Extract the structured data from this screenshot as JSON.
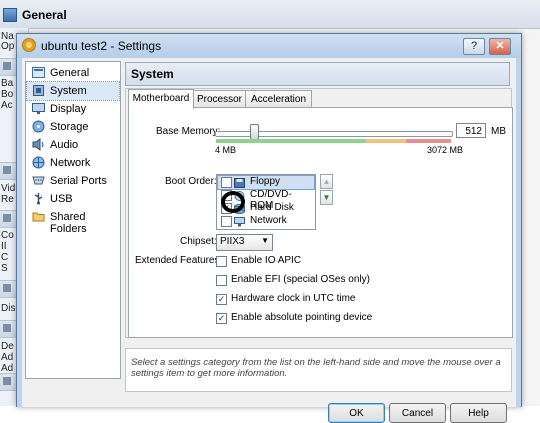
{
  "background_window": {
    "title": "General",
    "side_snippets": [
      "Na",
      "Op",
      "Ba",
      "Bo",
      "Ac",
      "Vid",
      "Re",
      "Co",
      "II",
      "C",
      "S",
      "Dis",
      "De",
      "Ad",
      "Ad"
    ]
  },
  "dialog": {
    "title": "ubuntu test2 - Settings",
    "window_buttons": {
      "help": "?",
      "minimize": "▭",
      "close": "✕"
    }
  },
  "categories": [
    {
      "label": "General",
      "icon": "general-icon",
      "selected": false
    },
    {
      "label": "System",
      "icon": "system-icon",
      "selected": true
    },
    {
      "label": "Display",
      "icon": "display-icon",
      "selected": false
    },
    {
      "label": "Storage",
      "icon": "storage-icon",
      "selected": false
    },
    {
      "label": "Audio",
      "icon": "audio-icon",
      "selected": false
    },
    {
      "label": "Network",
      "icon": "network-icon",
      "selected": false
    },
    {
      "label": "Serial Ports",
      "icon": "serial-port-icon",
      "selected": false
    },
    {
      "label": "USB",
      "icon": "usb-icon",
      "selected": false
    },
    {
      "label": "Shared Folders",
      "icon": "shared-folder-icon",
      "selected": false
    }
  ],
  "page": {
    "title": "System",
    "tabs": [
      {
        "label": "Motherboard",
        "active": true
      },
      {
        "label": "Processor",
        "active": false
      },
      {
        "label": "Acceleration",
        "active": false
      }
    ]
  },
  "motherboard": {
    "base_memory_label": "Base Memory:",
    "base_memory_value": "512",
    "base_memory_unit": "MB",
    "slider_min_label": "4 MB",
    "slider_max_label": "3072 MB",
    "slider_fraction": 0.165,
    "boot_order_label": "Boot Order:",
    "boot_items": [
      {
        "label": "Floppy",
        "checked": false,
        "selected": true
      },
      {
        "label": "CD/DVD-ROM",
        "checked": true,
        "selected": false
      },
      {
        "label": "Hard Disk",
        "checked": true,
        "selected": false
      },
      {
        "label": "Network",
        "checked": false,
        "selected": false
      }
    ],
    "chipset_label": "Chipset:",
    "chipset_value": "PIIX3",
    "extended_features_label": "Extended Features:",
    "features": [
      {
        "label": "Enable IO APIC",
        "checked": false
      },
      {
        "label": "Enable EFI (special OSes only)",
        "checked": false
      },
      {
        "label": "Hardware clock in UTC time",
        "checked": true
      },
      {
        "label": "Enable absolute pointing device",
        "checked": true
      }
    ]
  },
  "info_text": "Select a settings category from the list on the left-hand side and move the mouse over a settings item to get more information.",
  "buttons": {
    "ok": "OK",
    "cancel": "Cancel",
    "help": "Help"
  },
  "colors": {
    "accent": "#3c7fb1",
    "selection": "#dbe8f7",
    "slider_green": "#8fd18f",
    "slider_orange": "#f2c07a",
    "slider_red": "#e88f8f"
  }
}
